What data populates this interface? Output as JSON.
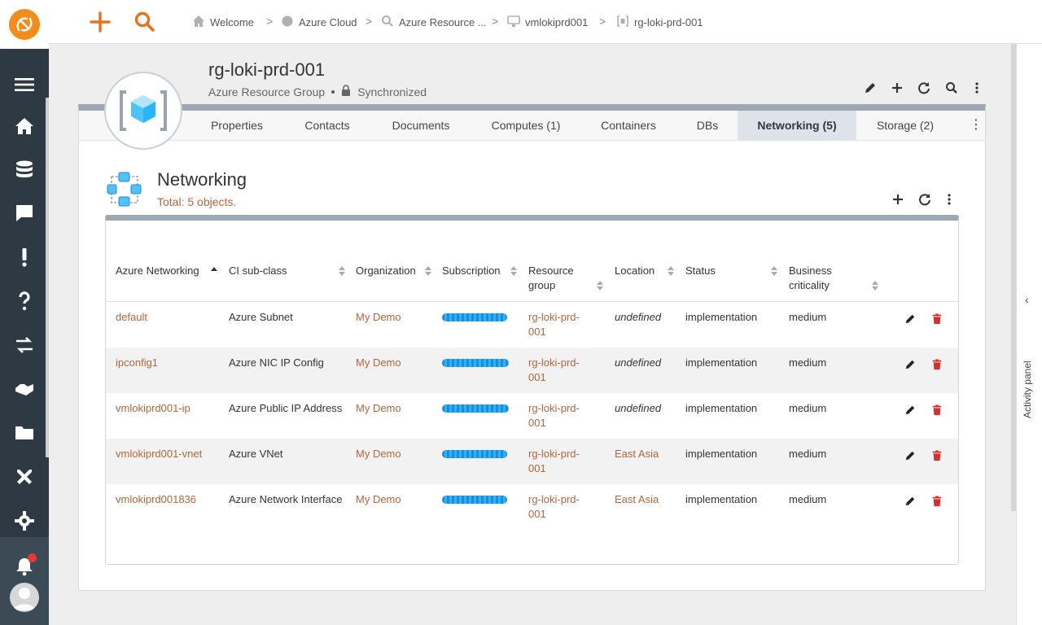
{
  "colors": {
    "sidebar": "#2d3a44",
    "accent": "#f28c1b",
    "link": "#b7643a",
    "danger": "#d32f2f"
  },
  "breadcrumb": [
    {
      "icon": "home-icon",
      "label": "Welcome"
    },
    {
      "icon": "cloud-chart-icon",
      "label": "Azure Cloud"
    },
    {
      "icon": "search-icon",
      "label": "Azure Resource ..."
    },
    {
      "icon": "monitor-icon",
      "label": "vmlokiprd001"
    },
    {
      "icon": "resource-group-icon",
      "label": "rg-loki-prd-001"
    }
  ],
  "header": {
    "title": "rg-loki-prd-001",
    "type": "Azure Resource Group",
    "sync_status": "Synchronized"
  },
  "tabs": [
    {
      "label": "Properties",
      "active": false
    },
    {
      "label": "Contacts",
      "active": false
    },
    {
      "label": "Documents",
      "active": false
    },
    {
      "label": "Computes (1)",
      "active": false
    },
    {
      "label": "Containers",
      "active": false
    },
    {
      "label": "DBs",
      "active": false
    },
    {
      "label": "Networking (5)",
      "active": true
    },
    {
      "label": "Storage (2)",
      "active": false
    }
  ],
  "section": {
    "title": "Networking",
    "total": "Total: 5 objects."
  },
  "table": {
    "columns": [
      {
        "label": "Azure Networking"
      },
      {
        "label": "CI sub-class"
      },
      {
        "label": "Organization"
      },
      {
        "label": "Subscription"
      },
      {
        "label": "Resource group"
      },
      {
        "label": "Location"
      },
      {
        "label": "Status"
      },
      {
        "label": "Business criticality"
      }
    ],
    "rows": [
      {
        "name": "default",
        "subclass": "Azure Subnet",
        "org": "My Demo",
        "rg": "rg-loki-prd-001",
        "location": "undefined",
        "status": "implementation",
        "criticality": "medium"
      },
      {
        "name": "ipconfig1",
        "subclass": "Azure NIC IP Config",
        "org": "My Demo",
        "rg": "rg-loki-prd-001",
        "location": "undefined",
        "status": "implementation",
        "criticality": "medium"
      },
      {
        "name": "vmlokiprd001-ip",
        "subclass": "Azure Public IP Address",
        "org": "My Demo",
        "rg": "rg-loki-prd-001",
        "location": "undefined",
        "status": "implementation",
        "criticality": "medium"
      },
      {
        "name": "vmlokiprd001-vnet",
        "subclass": "Azure VNet",
        "org": "My Demo",
        "rg": "rg-loki-prd-001",
        "location": "East Asia",
        "status": "implementation",
        "criticality": "medium"
      },
      {
        "name": "vmlokiprd001836",
        "subclass": "Azure Network Interface",
        "org": "My Demo",
        "rg": "rg-loki-prd-001",
        "location": "East Asia",
        "status": "implementation",
        "criticality": "medium"
      }
    ]
  },
  "activity_panel": {
    "label": "Activity panel"
  }
}
